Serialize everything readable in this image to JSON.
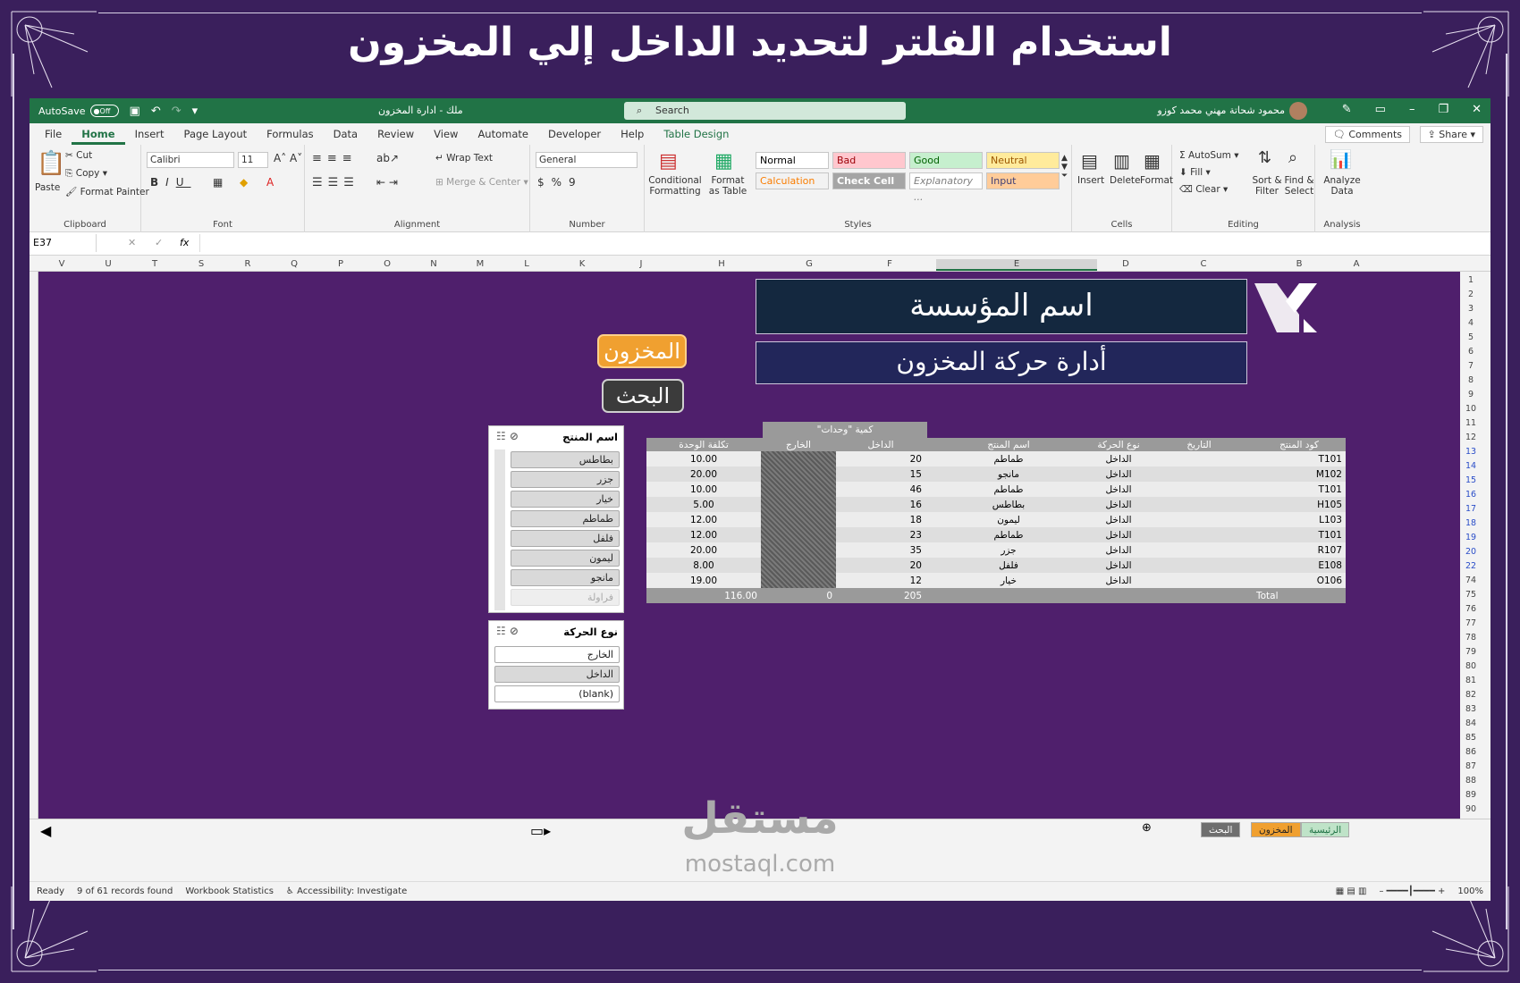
{
  "banner": {
    "title": "استخدام الفلتر  لتحديد الداخل إلي المخزون"
  },
  "titlebar": {
    "autosave": "AutoSave",
    "autosave_state": "Off",
    "doc_title": "ملك - ادارة المخزون",
    "search": "Search",
    "user": "محمود شحاتة مهني محمد كوزو"
  },
  "menu": {
    "tabs": [
      "File",
      "Home",
      "Insert",
      "Page Layout",
      "Formulas",
      "Data",
      "Review",
      "View",
      "Automate",
      "Developer",
      "Help",
      "Table Design"
    ],
    "comments": "Comments",
    "share": "Share"
  },
  "ribbon": {
    "clipboard": {
      "paste": "Paste",
      "cut": "Cut",
      "copy": "Copy",
      "format_painter": "Format Painter",
      "label": "Clipboard"
    },
    "font": {
      "name": "Calibri",
      "size": "11",
      "label": "Font"
    },
    "alignment": {
      "wrap": "Wrap Text",
      "merge": "Merge & Center",
      "label": "Alignment"
    },
    "number": {
      "format": "General",
      "label": "Number"
    },
    "styles": {
      "conditional": "Conditional Formatting",
      "format_table": "Format as Table",
      "cells": [
        {
          "text": "Normal",
          "bg": "#ffffff",
          "fg": "#000000"
        },
        {
          "text": "Bad",
          "bg": "#ffc7ce",
          "fg": "#9c0006"
        },
        {
          "text": "Good",
          "bg": "#c6efce",
          "fg": "#006100"
        },
        {
          "text": "Neutral",
          "bg": "#ffeb9c",
          "fg": "#9c5700"
        },
        {
          "text": "Calculation",
          "bg": "#f2f2f2",
          "fg": "#fa7d00"
        },
        {
          "text": "Check Cell",
          "bg": "#a5a5a5",
          "fg": "#ffffff"
        },
        {
          "text": "Explanatory ...",
          "bg": "#ffffff",
          "fg": "#7f7f7f"
        },
        {
          "text": "Input",
          "bg": "#ffcc99",
          "fg": "#3f3f76"
        }
      ],
      "label": "Styles"
    },
    "cells": {
      "insert": "Insert",
      "delete": "Delete",
      "format": "Format",
      "label": "Cells"
    },
    "editing": {
      "autosum": "AutoSum",
      "fill": "Fill",
      "clear": "Clear",
      "sort": "Sort & Filter",
      "find": "Find & Select",
      "label": "Editing"
    },
    "analysis": {
      "analyze": "Analyze Data",
      "label": "Analysis"
    }
  },
  "formula_bar": {
    "name_box": "E37",
    "fx": "fx"
  },
  "columns": [
    "V",
    "U",
    "T",
    "S",
    "R",
    "Q",
    "P",
    "O",
    "N",
    "M",
    "L",
    "K",
    "J",
    "H",
    "G",
    "F",
    "E",
    "D",
    "C",
    "B",
    "A"
  ],
  "rows": [
    {
      "n": "1",
      "blue": false
    },
    {
      "n": "2",
      "blue": false
    },
    {
      "n": "3",
      "blue": false
    },
    {
      "n": "4",
      "blue": false
    },
    {
      "n": "5",
      "blue": false
    },
    {
      "n": "6",
      "blue": false
    },
    {
      "n": "7",
      "blue": false
    },
    {
      "n": "8",
      "blue": false
    },
    {
      "n": "9",
      "blue": false
    },
    {
      "n": "10",
      "blue": false
    },
    {
      "n": "11",
      "blue": false
    },
    {
      "n": "12",
      "blue": false
    },
    {
      "n": "13",
      "blue": true
    },
    {
      "n": "14",
      "blue": true
    },
    {
      "n": "15",
      "blue": true
    },
    {
      "n": "16",
      "blue": true
    },
    {
      "n": "17",
      "blue": true
    },
    {
      "n": "18",
      "blue": true
    },
    {
      "n": "19",
      "blue": true
    },
    {
      "n": "20",
      "blue": true
    },
    {
      "n": "22",
      "blue": true
    },
    {
      "n": "74",
      "blue": false
    },
    {
      "n": "75",
      "blue": false
    },
    {
      "n": "76",
      "blue": false
    },
    {
      "n": "77",
      "blue": false
    },
    {
      "n": "78",
      "blue": false
    },
    {
      "n": "79",
      "blue": false
    },
    {
      "n": "80",
      "blue": false
    },
    {
      "n": "81",
      "blue": false
    },
    {
      "n": "82",
      "blue": false
    },
    {
      "n": "83",
      "blue": false
    },
    {
      "n": "84",
      "blue": false
    },
    {
      "n": "85",
      "blue": false
    },
    {
      "n": "86",
      "blue": false
    },
    {
      "n": "87",
      "blue": false
    },
    {
      "n": "88",
      "blue": false
    },
    {
      "n": "89",
      "blue": false
    },
    {
      "n": "90",
      "blue": false
    }
  ],
  "sheet": {
    "company_name": "اسم المؤسسة",
    "subtitle": "أدارة حركة المخزون",
    "btn_inventory": "المخزون",
    "btn_search": "البحث",
    "quantity_header": "كمية \"وحدات\"",
    "table": {
      "headers": [
        "تكلفة الوحدة",
        "الخارج",
        "الداخل",
        "اسم المنتج",
        "نوع الحركة",
        "التاريخ",
        "كود المنتج"
      ],
      "rows": [
        [
          "10.00",
          "",
          "20",
          "طماطم",
          "الداخل",
          "",
          "T101"
        ],
        [
          "20.00",
          "",
          "15",
          "مانجو",
          "الداخل",
          "",
          "M102"
        ],
        [
          "10.00",
          "",
          "46",
          "طماطم",
          "الداخل",
          "",
          "T101"
        ],
        [
          "5.00",
          "",
          "16",
          "بطاطس",
          "الداخل",
          "",
          "H105"
        ],
        [
          "12.00",
          "",
          "18",
          "ليمون",
          "الداخل",
          "",
          "L103"
        ],
        [
          "12.00",
          "",
          "23",
          "طماطم",
          "الداخل",
          "",
          "T101"
        ],
        [
          "20.00",
          "",
          "35",
          "جزر",
          "الداخل",
          "",
          "R107"
        ],
        [
          "8.00",
          "",
          "20",
          "فلفل",
          "الداخل",
          "",
          "E108"
        ],
        [
          "19.00",
          "",
          "12",
          "خيار",
          "الداخل",
          "",
          "O106"
        ]
      ],
      "total": [
        "116.00",
        "0",
        "205",
        "",
        "",
        "",
        "Total"
      ]
    },
    "slicer_product": {
      "title": "اسم المنتج",
      "items": [
        {
          "label": "بطاطس",
          "state": "on"
        },
        {
          "label": "جزر",
          "state": "on"
        },
        {
          "label": "خيار",
          "state": "on"
        },
        {
          "label": "طماطم",
          "state": "on"
        },
        {
          "label": "فلفل",
          "state": "on"
        },
        {
          "label": "ليمون",
          "state": "on"
        },
        {
          "label": "مانجو",
          "state": "on"
        },
        {
          "label": "فراولة",
          "state": "dim"
        }
      ]
    },
    "slicer_type": {
      "title": "نوع الحركة",
      "items": [
        {
          "label": "الخارج",
          "state": "off"
        },
        {
          "label": "الداخل",
          "state": "on"
        },
        {
          "label": "(blank)",
          "state": "off"
        }
      ]
    }
  },
  "sheet_tabs": [
    {
      "label": "البحث",
      "bg": "#6e6e6e",
      "fg": "#ffffff"
    },
    {
      "label": "المخزون",
      "bg": "#f0a030",
      "fg": "#222222"
    },
    {
      "label": "الرئيسية",
      "bg": "#bfe3c8",
      "fg": "#217346"
    }
  ],
  "status": {
    "ready": "Ready",
    "records": "9 of 61 records found",
    "stats": "Workbook Statistics",
    "accessibility": "Accessibility: Investigate",
    "zoom": "100%"
  },
  "watermark": {
    "arabic": "مستقل",
    "latin": "mostaql.com"
  }
}
